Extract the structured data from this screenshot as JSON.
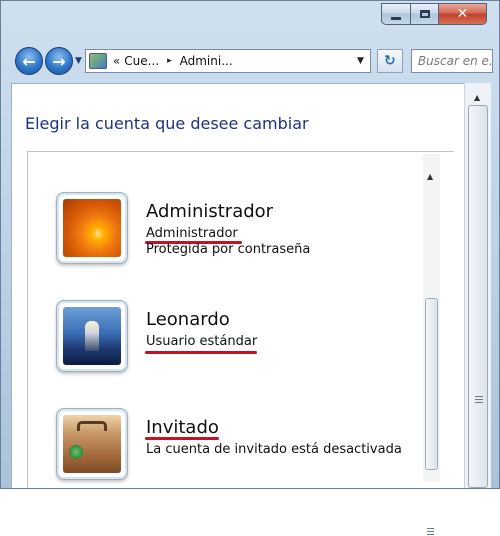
{
  "window": {
    "caption_buttons": {
      "minimize_icon": "minimize-icon",
      "maximize_icon": "maximize-icon",
      "close_icon": "close-icon"
    }
  },
  "navbar": {
    "back_icon": "back-arrow-icon",
    "forward_icon": "forward-arrow-icon",
    "address": {
      "overflow": "«",
      "crumbs": [
        "Cue...",
        "Admini..."
      ],
      "separator": "▸"
    },
    "search_placeholder": "Buscar en e..."
  },
  "page": {
    "heading": "Elegir la cuenta que desee cambiar"
  },
  "accounts": [
    {
      "name": "Administrador",
      "type": "Administrador",
      "desc": "Protegida por contraseña",
      "picture": "orange-flower"
    },
    {
      "name": "Leonardo",
      "type": "Usuario estándar",
      "desc": "",
      "picture": "lighthouse"
    },
    {
      "name": "Invitado",
      "type": "",
      "desc": "La cuenta de invitado está desactivada",
      "picture": "suitcase"
    }
  ],
  "colors": {
    "heading": "#1e3287",
    "annotation_underline": "#c41220"
  }
}
